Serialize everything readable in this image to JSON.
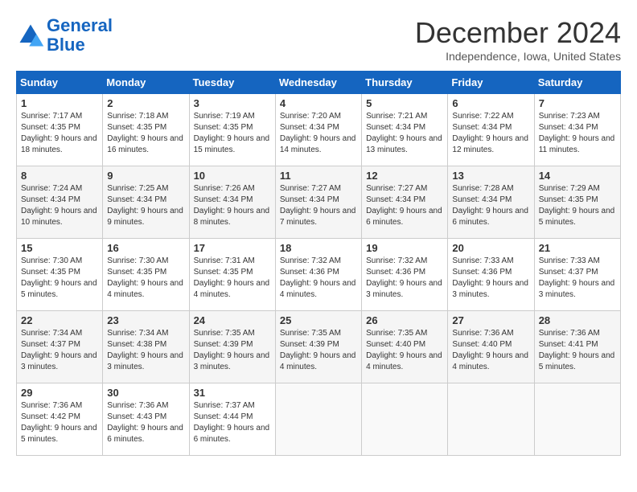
{
  "logo": {
    "line1": "General",
    "line2": "Blue"
  },
  "title": "December 2024",
  "location": "Independence, Iowa, United States",
  "days_of_week": [
    "Sunday",
    "Monday",
    "Tuesday",
    "Wednesday",
    "Thursday",
    "Friday",
    "Saturday"
  ],
  "weeks": [
    [
      {
        "day": 1,
        "sunrise": "7:17 AM",
        "sunset": "4:35 PM",
        "daylight_hours": 9,
        "daylight_minutes": 18
      },
      {
        "day": 2,
        "sunrise": "7:18 AM",
        "sunset": "4:35 PM",
        "daylight_hours": 9,
        "daylight_minutes": 16
      },
      {
        "day": 3,
        "sunrise": "7:19 AM",
        "sunset": "4:35 PM",
        "daylight_hours": 9,
        "daylight_minutes": 15
      },
      {
        "day": 4,
        "sunrise": "7:20 AM",
        "sunset": "4:34 PM",
        "daylight_hours": 9,
        "daylight_minutes": 14
      },
      {
        "day": 5,
        "sunrise": "7:21 AM",
        "sunset": "4:34 PM",
        "daylight_hours": 9,
        "daylight_minutes": 13
      },
      {
        "day": 6,
        "sunrise": "7:22 AM",
        "sunset": "4:34 PM",
        "daylight_hours": 9,
        "daylight_minutes": 12
      },
      {
        "day": 7,
        "sunrise": "7:23 AM",
        "sunset": "4:34 PM",
        "daylight_hours": 9,
        "daylight_minutes": 11
      }
    ],
    [
      {
        "day": 8,
        "sunrise": "7:24 AM",
        "sunset": "4:34 PM",
        "daylight_hours": 9,
        "daylight_minutes": 10
      },
      {
        "day": 9,
        "sunrise": "7:25 AM",
        "sunset": "4:34 PM",
        "daylight_hours": 9,
        "daylight_minutes": 9
      },
      {
        "day": 10,
        "sunrise": "7:26 AM",
        "sunset": "4:34 PM",
        "daylight_hours": 9,
        "daylight_minutes": 8
      },
      {
        "day": 11,
        "sunrise": "7:27 AM",
        "sunset": "4:34 PM",
        "daylight_hours": 9,
        "daylight_minutes": 7
      },
      {
        "day": 12,
        "sunrise": "7:27 AM",
        "sunset": "4:34 PM",
        "daylight_hours": 9,
        "daylight_minutes": 6
      },
      {
        "day": 13,
        "sunrise": "7:28 AM",
        "sunset": "4:34 PM",
        "daylight_hours": 9,
        "daylight_minutes": 6
      },
      {
        "day": 14,
        "sunrise": "7:29 AM",
        "sunset": "4:35 PM",
        "daylight_hours": 9,
        "daylight_minutes": 5
      }
    ],
    [
      {
        "day": 15,
        "sunrise": "7:30 AM",
        "sunset": "4:35 PM",
        "daylight_hours": 9,
        "daylight_minutes": 5
      },
      {
        "day": 16,
        "sunrise": "7:30 AM",
        "sunset": "4:35 PM",
        "daylight_hours": 9,
        "daylight_minutes": 4
      },
      {
        "day": 17,
        "sunrise": "7:31 AM",
        "sunset": "4:35 PM",
        "daylight_hours": 9,
        "daylight_minutes": 4
      },
      {
        "day": 18,
        "sunrise": "7:32 AM",
        "sunset": "4:36 PM",
        "daylight_hours": 9,
        "daylight_minutes": 4
      },
      {
        "day": 19,
        "sunrise": "7:32 AM",
        "sunset": "4:36 PM",
        "daylight_hours": 9,
        "daylight_minutes": 3
      },
      {
        "day": 20,
        "sunrise": "7:33 AM",
        "sunset": "4:36 PM",
        "daylight_hours": 9,
        "daylight_minutes": 3
      },
      {
        "day": 21,
        "sunrise": "7:33 AM",
        "sunset": "4:37 PM",
        "daylight_hours": 9,
        "daylight_minutes": 3
      }
    ],
    [
      {
        "day": 22,
        "sunrise": "7:34 AM",
        "sunset": "4:37 PM",
        "daylight_hours": 9,
        "daylight_minutes": 3
      },
      {
        "day": 23,
        "sunrise": "7:34 AM",
        "sunset": "4:38 PM",
        "daylight_hours": 9,
        "daylight_minutes": 3
      },
      {
        "day": 24,
        "sunrise": "7:35 AM",
        "sunset": "4:39 PM",
        "daylight_hours": 9,
        "daylight_minutes": 3
      },
      {
        "day": 25,
        "sunrise": "7:35 AM",
        "sunset": "4:39 PM",
        "daylight_hours": 9,
        "daylight_minutes": 4
      },
      {
        "day": 26,
        "sunrise": "7:35 AM",
        "sunset": "4:40 PM",
        "daylight_hours": 9,
        "daylight_minutes": 4
      },
      {
        "day": 27,
        "sunrise": "7:36 AM",
        "sunset": "4:40 PM",
        "daylight_hours": 9,
        "daylight_minutes": 4
      },
      {
        "day": 28,
        "sunrise": "7:36 AM",
        "sunset": "4:41 PM",
        "daylight_hours": 9,
        "daylight_minutes": 5
      }
    ],
    [
      {
        "day": 29,
        "sunrise": "7:36 AM",
        "sunset": "4:42 PM",
        "daylight_hours": 9,
        "daylight_minutes": 5
      },
      {
        "day": 30,
        "sunrise": "7:36 AM",
        "sunset": "4:43 PM",
        "daylight_hours": 9,
        "daylight_minutes": 6
      },
      {
        "day": 31,
        "sunrise": "7:37 AM",
        "sunset": "4:44 PM",
        "daylight_hours": 9,
        "daylight_minutes": 6
      },
      null,
      null,
      null,
      null
    ]
  ]
}
